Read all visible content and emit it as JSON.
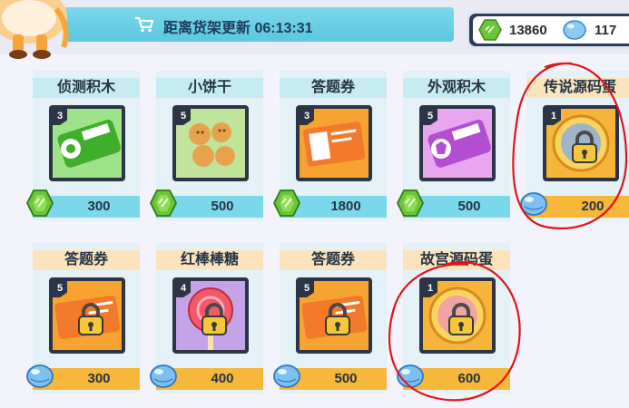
{
  "header": {
    "refresh_label": "距离货架更新 06:13:31"
  },
  "currency": {
    "gems": "13860",
    "crystals": "117"
  },
  "colors": {
    "cyan": "#7ad8ea",
    "orange": "#f7b73a",
    "dark": "#2d3445",
    "annotation_red": "#e0141a"
  },
  "row1": [
    {
      "title": "侦测积木",
      "level": "3",
      "price": "300",
      "currency": "gem-icon",
      "art": "green-key"
    },
    {
      "title": "小饼干",
      "level": "5",
      "price": "500",
      "currency": "gem-icon",
      "art": "cookies"
    },
    {
      "title": "答题券",
      "level": "3",
      "price": "1800",
      "currency": "gem-icon",
      "art": "ticket"
    },
    {
      "title": "外观积木",
      "level": "5",
      "price": "500",
      "currency": "gem-icon",
      "art": "purple-key"
    },
    {
      "title": "传说源码蛋",
      "level": "1",
      "price": "200",
      "currency": "crystal-icon",
      "art": "locked-egg"
    }
  ],
  "row2": [
    {
      "title": "答题券",
      "level": "5",
      "price": "300",
      "currency": "crystal-icon",
      "art": "locked-ticket"
    },
    {
      "title": "红棒棒糖",
      "level": "4",
      "price": "400",
      "currency": "crystal-icon",
      "art": "locked-lollipop"
    },
    {
      "title": "答题券",
      "level": "5",
      "price": "500",
      "currency": "crystal-icon",
      "art": "locked-ticket"
    },
    {
      "title": "故宫源码蛋",
      "level": "1",
      "price": "600",
      "currency": "crystal-icon",
      "art": "locked-palace-egg"
    }
  ]
}
